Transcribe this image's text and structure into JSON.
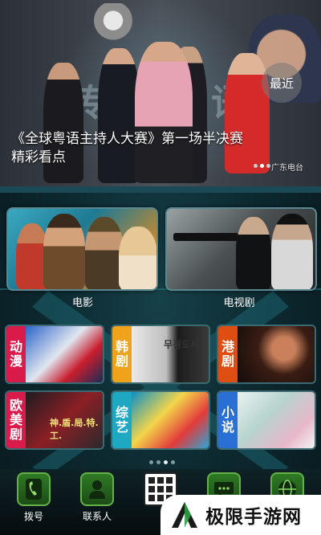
{
  "banner": {
    "headline": "《全球粤语主持人大赛》第一场半决赛精彩看点",
    "recent_label": "最近",
    "source": "广东电台",
    "slide_count": 3,
    "active_slide": 1
  },
  "featured": [
    {
      "id": "movie",
      "label": "电影"
    },
    {
      "id": "tv",
      "label": "电视剧"
    }
  ],
  "categories": [
    {
      "id": "anime",
      "tag": "动漫",
      "color": "#d81b4a"
    },
    {
      "id": "korean",
      "tag": "韩剧",
      "color": "#f0a21a"
    },
    {
      "id": "hk",
      "tag": "港剧",
      "color": "#e04d12"
    },
    {
      "id": "western",
      "tag": "欧美剧",
      "color": "#d81b4a"
    },
    {
      "id": "variety",
      "tag": "综艺",
      "color": "#1fa8c2"
    },
    {
      "id": "novel",
      "tag": "小说",
      "color": "#2a6fd3"
    }
  ],
  "category_art": {
    "korean_title": "무정도시",
    "western_title": "神.盾.局.特.工."
  },
  "page_indicator": {
    "count": 4,
    "active": 2
  },
  "dock": [
    {
      "id": "dial",
      "label": "拨号",
      "icon": "phone-icon"
    },
    {
      "id": "contacts",
      "label": "联系人",
      "icon": "person-icon"
    },
    {
      "id": "apps",
      "label": "",
      "icon": "app-grid-icon"
    },
    {
      "id": "sms",
      "label": "",
      "icon": "chat-bubble-icon"
    },
    {
      "id": "web",
      "label": "",
      "icon": "globe-icon"
    }
  ],
  "watermark": {
    "text": "极限手游网"
  },
  "colors": {
    "accent": "#66b04a",
    "frame": "#5a8890"
  }
}
